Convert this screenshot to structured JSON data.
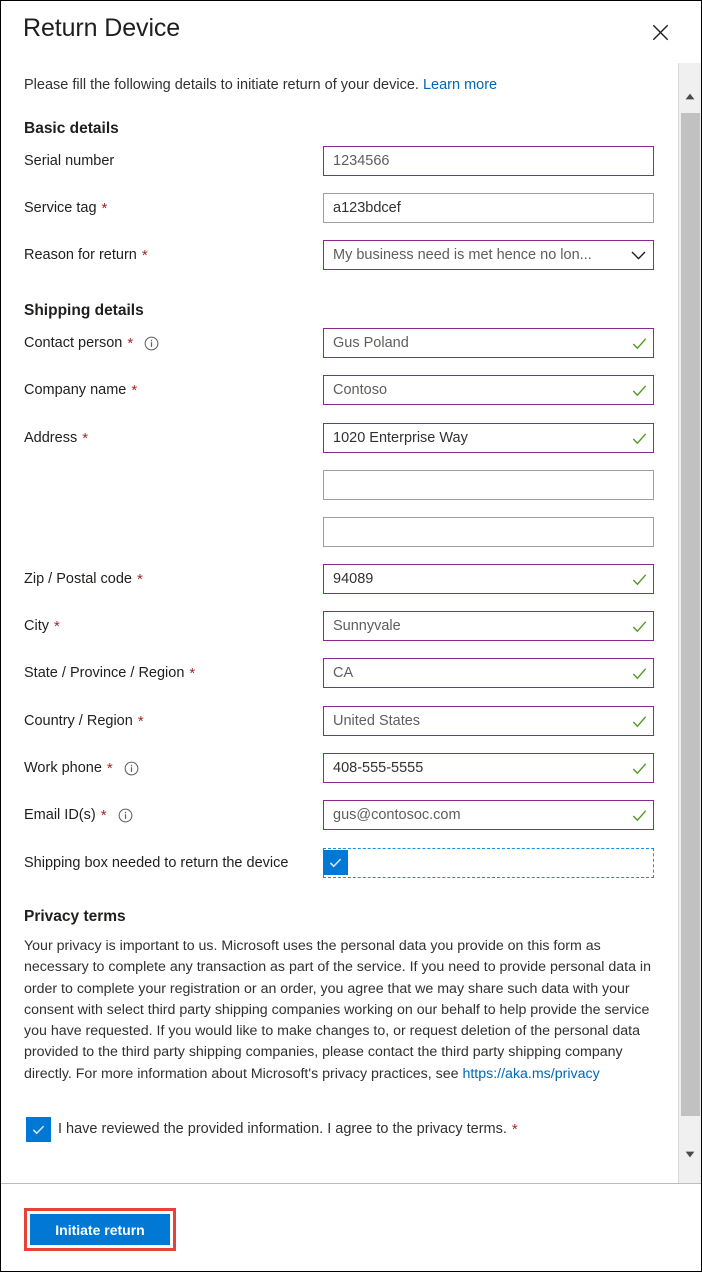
{
  "dialog": {
    "title": "Return Device",
    "close_icon": "close-icon",
    "intro_text": "Please fill the following details to initiate return of your device.",
    "intro_link": "Learn more"
  },
  "sections": {
    "basic": {
      "title": "Basic details"
    },
    "shipping": {
      "title": "Shipping details"
    },
    "privacy": {
      "title": "Privacy terms"
    }
  },
  "basic_fields": [
    {
      "label": "Serial number",
      "required": false,
      "info": false,
      "value": "1234566",
      "border": "purple",
      "valid": false,
      "dim": true,
      "type": "text"
    },
    {
      "label": "Service tag",
      "required": true,
      "info": false,
      "value": "a123bdcef",
      "border": "gray",
      "valid": false,
      "dim": false,
      "type": "text"
    },
    {
      "label": "Reason for return",
      "required": true,
      "info": false,
      "value": "My business need is met hence no lon...",
      "border": "purple",
      "valid": false,
      "dim": true,
      "type": "select"
    }
  ],
  "shipping_fields": [
    {
      "label": "Contact person",
      "required": true,
      "info": true,
      "value": "Gus Poland",
      "border": "purple",
      "valid": true,
      "dim": true,
      "type": "text"
    },
    {
      "label": "Company name",
      "required": true,
      "info": false,
      "value": "Contoso",
      "border": "purple",
      "valid": true,
      "dim": true,
      "type": "text"
    },
    {
      "label": "Address",
      "required": true,
      "info": false,
      "value": "1020 Enterprise Way",
      "border": "purple",
      "valid": true,
      "dim": false,
      "type": "text"
    },
    {
      "label": "",
      "required": false,
      "info": false,
      "value": "",
      "border": "gray",
      "valid": false,
      "dim": false,
      "type": "text"
    },
    {
      "label": "",
      "required": false,
      "info": false,
      "value": "",
      "border": "gray",
      "valid": false,
      "dim": false,
      "type": "text"
    },
    {
      "label": "Zip / Postal code",
      "required": true,
      "info": false,
      "value": "94089",
      "border": "purple",
      "valid": true,
      "dim": false,
      "type": "text"
    },
    {
      "label": "City",
      "required": true,
      "info": false,
      "value": "Sunnyvale",
      "border": "purple",
      "valid": true,
      "dim": true,
      "type": "text"
    },
    {
      "label": "State / Province / Region",
      "required": true,
      "info": false,
      "value": "CA",
      "border": "purple",
      "valid": true,
      "dim": true,
      "type": "text"
    },
    {
      "label": "Country / Region",
      "required": true,
      "info": false,
      "value": "United States",
      "border": "purple",
      "valid": true,
      "dim": true,
      "type": "text"
    },
    {
      "label": "Work phone",
      "required": true,
      "info": true,
      "value": "408-555-5555",
      "border": "purple",
      "valid": true,
      "dim": false,
      "type": "text"
    },
    {
      "label": "Email ID(s)",
      "required": true,
      "info": true,
      "value": "gus@contosoc.com",
      "border": "purple",
      "valid": true,
      "dim": true,
      "type": "text"
    }
  ],
  "shipping_box": {
    "label": "Shipping box needed to return the device",
    "checked": true
  },
  "privacy": {
    "body_part1": "Your privacy is important to us. Microsoft uses the personal data you provide on this form as necessary to complete any transaction as part of the service. If you need to provide personal data in order to complete your registration or an order, you agree that we may share such data with your consent with select third party shipping companies working on our behalf to help provide the service you have requested. If you would like to make changes to, or request deletion of the personal data provided to the third party shipping companies, please contact the third party shipping company directly. For more information about Microsoft's privacy practices, see ",
    "body_link": "https://aka.ms/privacy",
    "consent_label": "I have reviewed the provided information. I agree to the privacy terms.",
    "consent_required": "*",
    "consent_checked": true
  },
  "footer": {
    "submit_label": "Initiate return"
  },
  "scrollbar": {
    "up_icon": "caret-up-icon",
    "down_icon": "caret-down-icon",
    "thumb": "scroll-thumb"
  },
  "colors": {
    "accent_blue": "#0078d4",
    "link_blue": "#0067b8",
    "field_focus_purple": "#8a2a8f",
    "valid_green": "#4f9a26",
    "required_red": "#a4262c",
    "annotation_red": "#e8413a",
    "focus_dashed_blue": "#1b8fe0"
  }
}
